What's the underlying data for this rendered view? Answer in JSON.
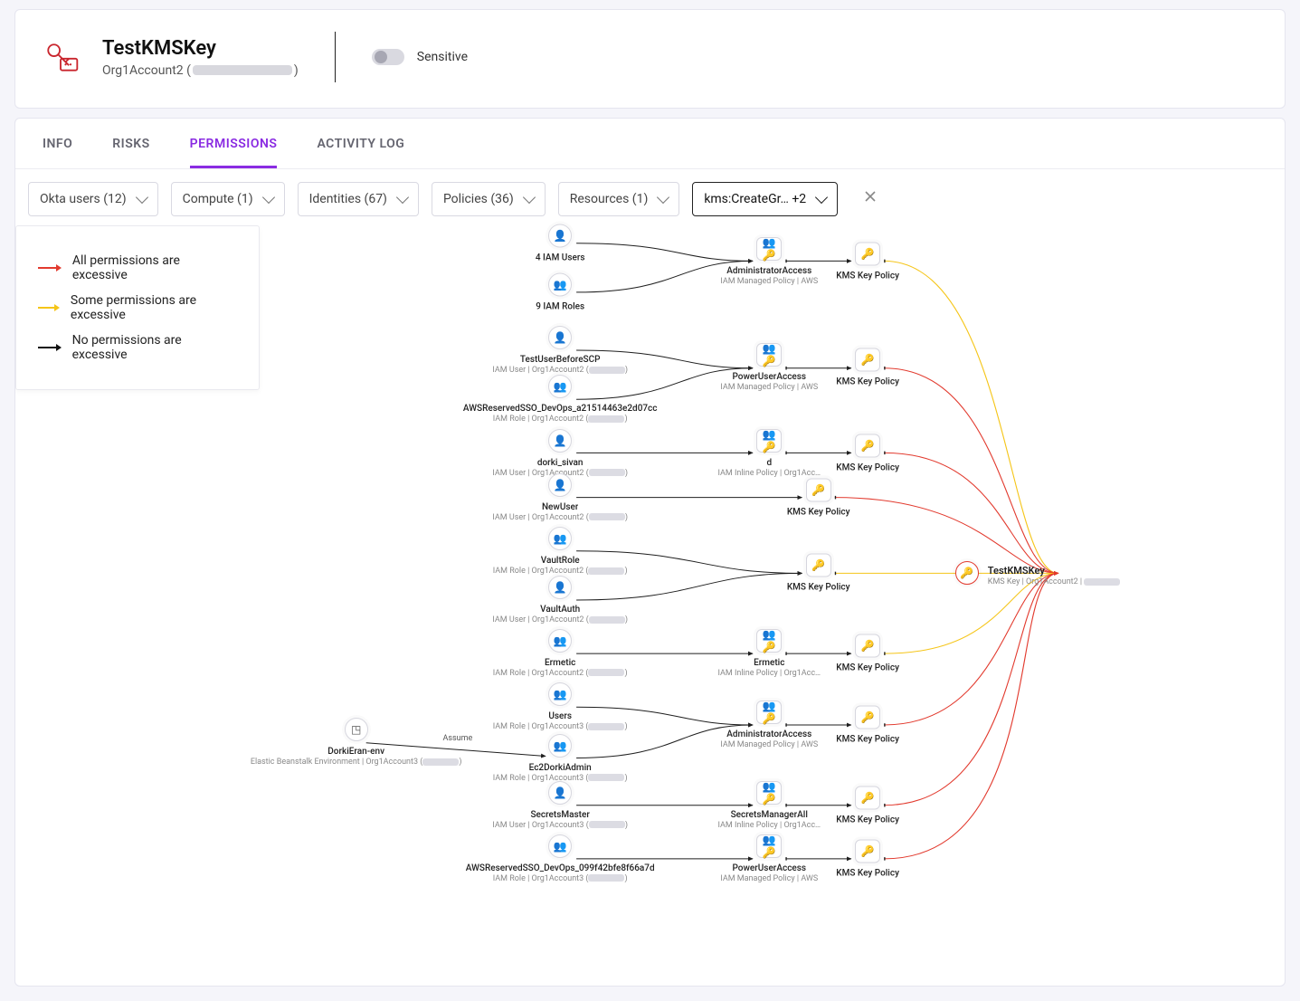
{
  "header": {
    "title": "TestKMSKey",
    "account_label": "Org1Account2 (",
    "account_label_close": ")",
    "sensitive_label": "Sensitive"
  },
  "tabs": [
    {
      "id": "info",
      "label": "INFO"
    },
    {
      "id": "risks",
      "label": "RISKS"
    },
    {
      "id": "permissions",
      "label": "PERMISSIONS"
    },
    {
      "id": "activity",
      "label": "ACTIVITY LOG"
    }
  ],
  "active_tab_id": "permissions",
  "filters": [
    {
      "id": "okta",
      "label": "Okta users (12)"
    },
    {
      "id": "comp",
      "label": "Compute (1)"
    },
    {
      "id": "ident",
      "label": "Identities (67)"
    },
    {
      "id": "pol",
      "label": "Policies (36)"
    },
    {
      "id": "res",
      "label": "Resources (1)"
    },
    {
      "id": "action",
      "label": "kms:CreateGr… +2",
      "strong": true
    }
  ],
  "legend": [
    {
      "color": "red",
      "text": "All permissions are excessive"
    },
    {
      "color": "yellow",
      "text": "Some permissions are excessive"
    },
    {
      "color": "black",
      "text": "No permissions are excessive"
    }
  ],
  "edge_labels": {
    "assume": "Assume"
  },
  "graph": {
    "target": {
      "name": "TestKMSKey",
      "sub": "KMS Key | Org1Account2 |"
    },
    "identity_nodes": [
      {
        "id": "iamusers",
        "icon": "user",
        "name": "4 IAM Users",
        "sub": ""
      },
      {
        "id": "iamroles",
        "icon": "users",
        "name": "9 IAM Roles",
        "sub": ""
      },
      {
        "id": "scpuser",
        "icon": "user",
        "name": "TestUserBeforeSCP",
        "sub": "IAM User | Org1Account2 ("
      },
      {
        "id": "ssorole1",
        "icon": "users",
        "name": "AWSReservedSSO_DevOps_a21514463e2d07cc",
        "sub": "IAM Role | Org1Account2 ("
      },
      {
        "id": "dorki",
        "icon": "user",
        "name": "dorki_sivan",
        "sub": "IAM User | Org1Account2 ("
      },
      {
        "id": "newuser",
        "icon": "user",
        "name": "NewUser",
        "sub": "IAM User | Org1Account2 ("
      },
      {
        "id": "vaultrole",
        "icon": "users",
        "name": "VaultRole",
        "sub": "IAM Role | Org1Account2 ("
      },
      {
        "id": "vaultauth",
        "icon": "user",
        "name": "VaultAuth",
        "sub": "IAM User | Org1Account2 ("
      },
      {
        "id": "ermetic",
        "icon": "users",
        "name": "Ermetic",
        "sub": "IAM Role | Org1Account2 ("
      },
      {
        "id": "users",
        "icon": "users",
        "name": "Users",
        "sub": "IAM Role | Org1Account3 ("
      },
      {
        "id": "ec2admin",
        "icon": "users",
        "name": "Ec2DorkiAdmin",
        "sub": "IAM Role | Org1Account3 ("
      },
      {
        "id": "secmaster",
        "icon": "user",
        "name": "SecretsMaster",
        "sub": "IAM User | Org1Account3 ("
      },
      {
        "id": "ssorole2",
        "icon": "users",
        "name": "AWSReservedSSO_DevOps_099f42bfe8f66a7d",
        "sub": "IAM Role | Org1Account3 ("
      }
    ],
    "compute_nodes": [
      {
        "id": "ebenv",
        "icon": "cube",
        "name": "DorkiEran-env",
        "sub": "Elastic Beanstalk Environment | Org1Account3 ("
      }
    ],
    "policy_nodes": [
      {
        "id": "adminacc1",
        "name": "AdministratorAccess",
        "sub": "IAM Managed Policy | AWS"
      },
      {
        "id": "poweruser1",
        "name": "PowerUserAccess",
        "sub": "IAM Managed Policy | AWS"
      },
      {
        "id": "d_inline",
        "name": "d",
        "sub": "IAM Inline Policy | Org1Acc…"
      },
      {
        "id": "ermeticpol",
        "name": "Ermetic",
        "sub": "IAM Inline Policy | Org1Acc…"
      },
      {
        "id": "adminacc2",
        "name": "AdministratorAccess",
        "sub": "IAM Managed Policy | AWS"
      },
      {
        "id": "secmgrall",
        "name": "SecretsManagerAll",
        "sub": "IAM Inline Policy | Org1Acc…"
      },
      {
        "id": "poweruser2",
        "name": "PowerUserAccess",
        "sub": "IAM Managed Policy | AWS"
      }
    ],
    "keypolicy_nodes": [
      {
        "id": "kp1",
        "name": "KMS Key Policy"
      },
      {
        "id": "kp2",
        "name": "KMS Key Policy"
      },
      {
        "id": "kp3",
        "name": "KMS Key Policy"
      },
      {
        "id": "kp4",
        "name": "KMS Key Policy"
      },
      {
        "id": "kp5",
        "name": "KMS Key Policy"
      },
      {
        "id": "kp6",
        "name": "KMS Key Policy"
      },
      {
        "id": "kp7",
        "name": "KMS Key Policy"
      },
      {
        "id": "kp8",
        "name": "KMS Key Policy"
      },
      {
        "id": "kp9",
        "name": "KMS Key Policy"
      }
    ],
    "colors": {
      "red": "#e23a2e",
      "yellow": "#f5c518",
      "black": "#1f1f1f",
      "gray": "#d8d8de"
    }
  }
}
